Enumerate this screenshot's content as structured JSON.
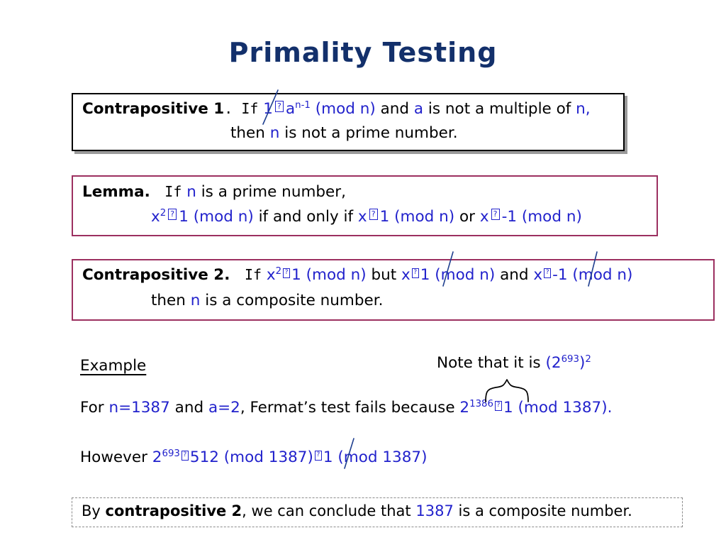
{
  "slide": {
    "title": "Primality Testing"
  },
  "contrapositive1": {
    "label": "Contrapositive 1",
    "line1_pre": ". If",
    "line1_one": "1",
    "line1_sym": "?",
    "line1_a": "a",
    "line1_a_exp": "n-1",
    "line1_mod": "(mod n)",
    "line1_and": "and",
    "line1_var_a": "a",
    "line1_tail": "is not a multiple of",
    "line1_n": "n,",
    "line2_then": "then",
    "line2_n": "n",
    "line2_tail": "is not a prime number."
  },
  "lemma": {
    "label": "Lemma.",
    "line1_if": "If",
    "line1_n": "n",
    "line1_tail": "is a prime number,",
    "line2_x": "x",
    "line2_x_exp": "2",
    "line2_sym": "?",
    "line2_one": "1 (mod n)",
    "line2_iff": "if and only if",
    "line2_x2": "x",
    "line2_sym2": "?",
    "line2_one2": "1 (mod n)",
    "line2_or": "or",
    "line2_x3": "x",
    "line2_sym3": "?",
    "line2_neg": "-1 (mod n)"
  },
  "contrapositive2": {
    "label": "Contrapositive 2.",
    "line1_if": "If",
    "line1_x": "x",
    "line1_x_exp": "2",
    "line1_sym": "?",
    "line1_one": "1 (mod n)",
    "line1_but": "but",
    "line1_x2": "x",
    "line1_sym2": "?",
    "line1_one2": "1 (mod n)",
    "line1_and": "and",
    "line1_x3": "x",
    "line1_sym3": "?",
    "line1_neg": "-1 (mod n)",
    "line2_then": "then",
    "line2_n": "n",
    "line2_tail": "is a composite number."
  },
  "example": {
    "heading": "Example ",
    "note_text": "Note that it is",
    "note_expr_open": "(2",
    "note_expr_exp": "693",
    "note_expr_close": ")",
    "note_expr_sq": "2",
    "for_pre": "For",
    "for_n": "n=1387",
    "for_and": "and",
    "for_a": "a=2",
    "for_mid": ", Fermat’s test fails because",
    "for_two": "2",
    "for_two_exp": "1386",
    "for_sym": "?",
    "for_tail": "1 (mod 1387).",
    "however_pre": "However",
    "however_two": "2",
    "however_two_exp": "693",
    "however_sym": "?",
    "however_mid": "512 (mod 1387)",
    "however_sym2": "?",
    "however_tail": "1 (mod 1387)"
  },
  "conclusion": {
    "by": "By",
    "ref": "contrapositive 2",
    "mid": ", we can conclude that",
    "number": "1387",
    "tail": "is a composite number."
  },
  "colors": {
    "title": "#13306b",
    "accent_blue": "#2222cc",
    "maroon_border": "#9c3060",
    "dashed_border": "#8c8c8c",
    "annotation": "#1f3f8f"
  }
}
